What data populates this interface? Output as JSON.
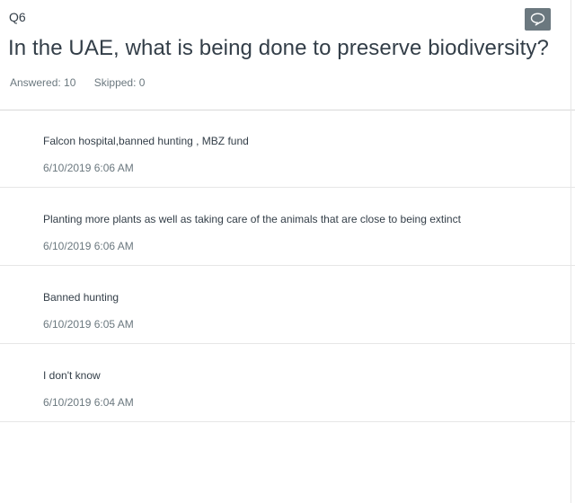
{
  "question": {
    "number": "Q6",
    "title": "In the UAE, what is being done to preserve biodiversity?",
    "answered_label": "Answered: 10",
    "skipped_label": "Skipped: 0"
  },
  "icons": {
    "comment": "comment-icon"
  },
  "colors": {
    "comment_button": "#6b787f",
    "text": "#333e48",
    "muted": "#6b787f"
  },
  "responses": [
    {
      "text": "Falcon hospital,banned hunting , MBZ fund",
      "timestamp": "6/10/2019 6:06 AM"
    },
    {
      "text": "Planting more plants as well as taking care of the animals that are close to being extinct",
      "timestamp": "6/10/2019 6:06 AM"
    },
    {
      "text": "Banned hunting",
      "timestamp": "6/10/2019 6:05 AM"
    },
    {
      "text": "I don't know",
      "timestamp": "6/10/2019 6:04 AM"
    }
  ]
}
